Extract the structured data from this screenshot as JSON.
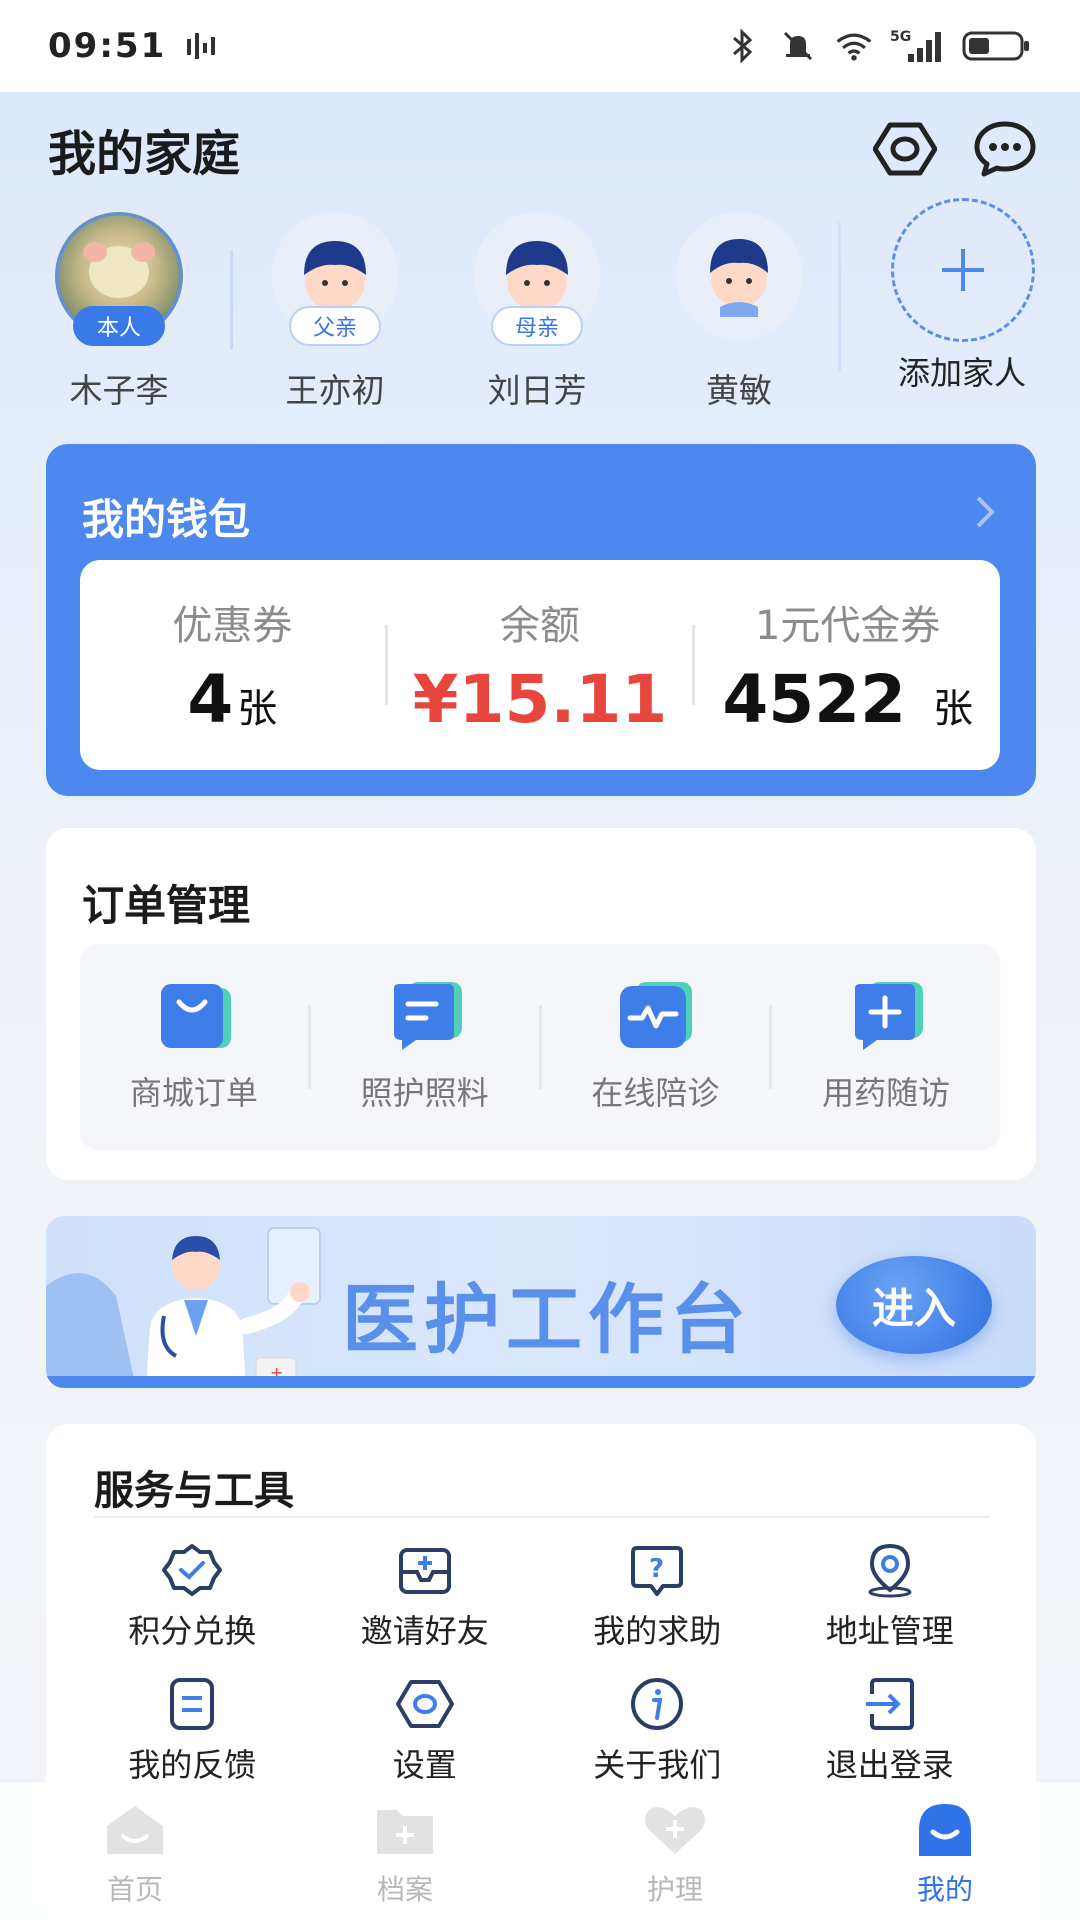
{
  "status_bar": {
    "time": "09:51",
    "network": "5G"
  },
  "header": {
    "title": "我的家庭",
    "settings_icon": "hexagon-settings-icon",
    "message_icon": "chat-bubble-icon"
  },
  "family": {
    "members": [
      {
        "name": "木子李",
        "role": "本人",
        "self": true
      },
      {
        "name": "王亦初",
        "role": "父亲",
        "self": false
      },
      {
        "name": "刘日芳",
        "role": "母亲",
        "self": false
      },
      {
        "name": "黄敏",
        "role": "",
        "self": false
      }
    ],
    "add_label": "添加家人"
  },
  "wallet": {
    "title": "我的钱包",
    "coupons_label": "优惠券",
    "coupons_value": "4",
    "coupons_unit": "张",
    "balance_label": "余额",
    "balance_value": "¥15.11",
    "voucher_label": "1元代金券",
    "voucher_value": "4522",
    "voucher_unit": "张",
    "accent": "#4c88ee"
  },
  "orders": {
    "title": "订单管理",
    "items": [
      {
        "label": "商城订单",
        "icon": "shopping-bag-icon"
      },
      {
        "label": "照护照料",
        "icon": "care-chat-icon"
      },
      {
        "label": "在线陪诊",
        "icon": "heartbeat-icon"
      },
      {
        "label": "用药随访",
        "icon": "medicine-plus-icon"
      }
    ]
  },
  "banner": {
    "text": "医护工作台",
    "button": "进入"
  },
  "services": {
    "title": "服务与工具",
    "items": [
      {
        "label": "积分兑换",
        "icon": "badge-check-icon"
      },
      {
        "label": "邀请好友",
        "icon": "invite-mail-icon"
      },
      {
        "label": "我的求助",
        "icon": "help-question-icon"
      },
      {
        "label": "地址管理",
        "icon": "location-pin-icon"
      },
      {
        "label": "我的反馈",
        "icon": "feedback-doc-icon"
      },
      {
        "label": "设置",
        "icon": "settings-icon"
      },
      {
        "label": "关于我们",
        "icon": "info-icon"
      },
      {
        "label": "退出登录",
        "icon": "logout-icon"
      }
    ]
  },
  "tabbar": {
    "tabs": [
      {
        "label": "首页",
        "icon": "home-icon",
        "active": false
      },
      {
        "label": "档案",
        "icon": "folder-icon",
        "active": false
      },
      {
        "label": "护理",
        "icon": "heart-icon",
        "active": false
      },
      {
        "label": "我的",
        "icon": "profile-icon",
        "active": true
      }
    ]
  }
}
